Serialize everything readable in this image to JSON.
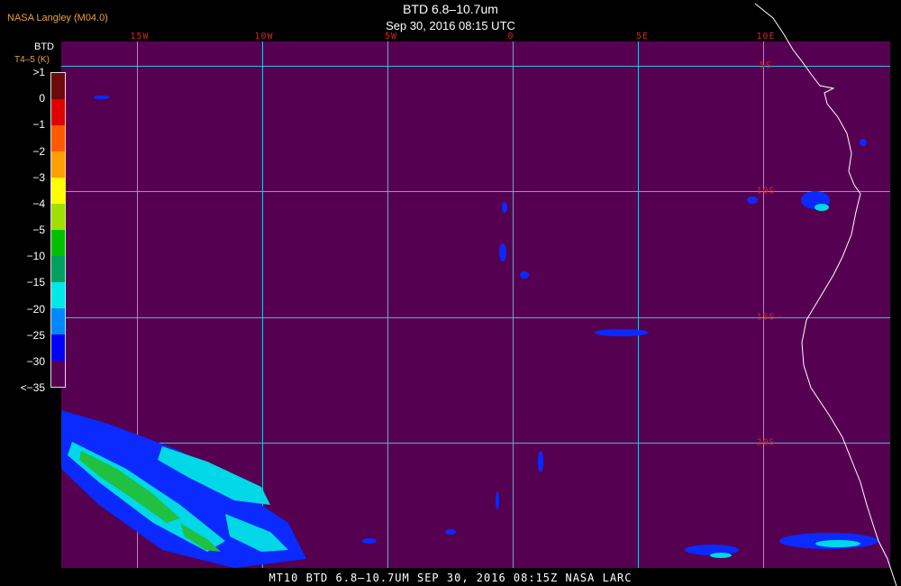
{
  "header": {
    "credit": "NASA Langley (M04.0)",
    "title": "BTD 6.8–10.7um",
    "timestamp": "Sep 30, 2016 08:15 UTC"
  },
  "colorbar": {
    "title": "BTD",
    "unit": "T4–5 (K)",
    "ticks": [
      ">1",
      "0",
      "−1",
      "−2",
      "−3",
      "−4",
      "−5",
      "−10",
      "−15",
      "−20",
      "−25",
      "−30",
      "<−35"
    ],
    "colors": [
      "#6a0a0a",
      "#e00000",
      "#ff5a00",
      "#ffa000",
      "#ffff00",
      "#a0e000",
      "#00c000",
      "#00a060",
      "#00e8e8",
      "#0088ff",
      "#0000ff",
      "#560052"
    ]
  },
  "map": {
    "longitude_labels": [
      "15W",
      "10W",
      "5W",
      "0",
      "5E",
      "10E"
    ],
    "latitude_labels": [
      "5S",
      "10S",
      "15S",
      "20S"
    ],
    "background_color": "#560052",
    "grid_color": "#3fb8d8",
    "coastline_color": "#ffffff"
  },
  "footer": {
    "caption": "MT10  BTD 6.8–10.7UM   SEP 30, 2016 08:15Z   NASA LARC"
  }
}
